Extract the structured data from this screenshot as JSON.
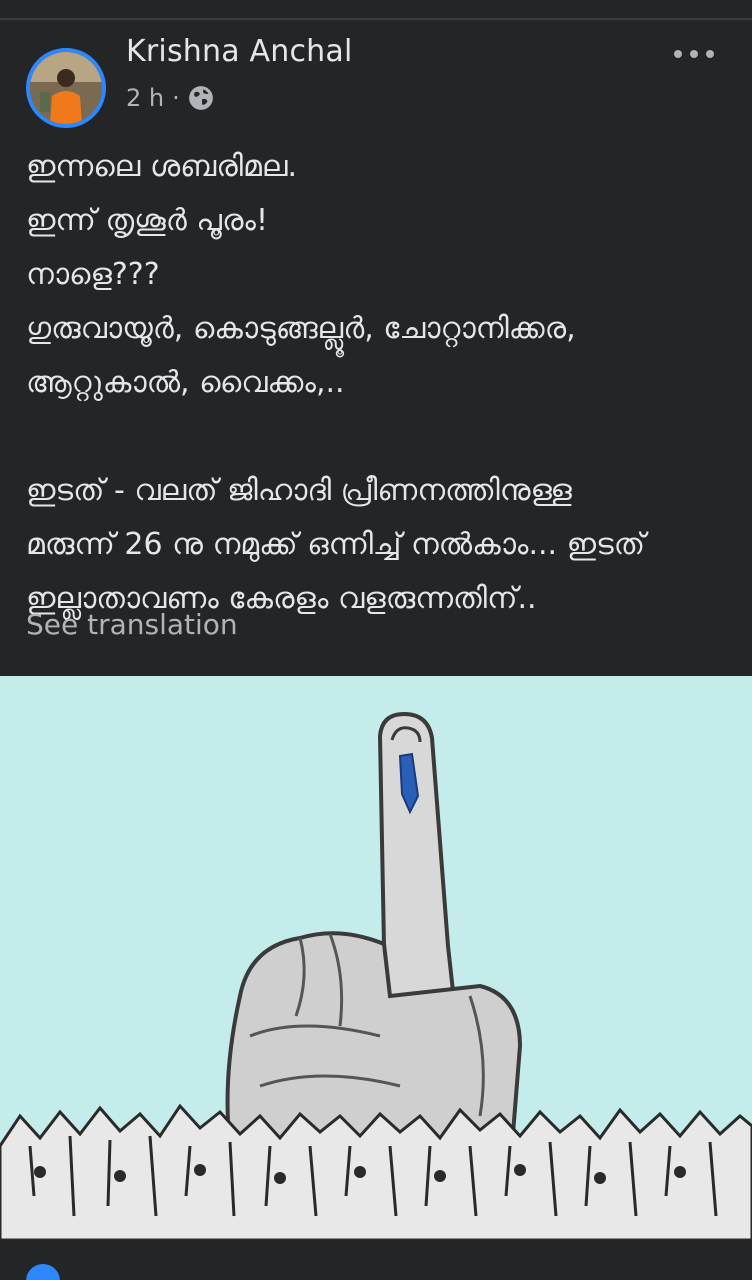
{
  "post": {
    "author_name": "Krishna Anchal",
    "time": "2 h",
    "separator": "·",
    "privacy_icon": "globe-icon",
    "more_icon": "more-options-icon",
    "text_lines": [
      "ഇന്നലെ ശബരിമല.",
      "ഇന്ന് തൃശൂർ പൂരം!",
      "നാളെ???",
      "ഗുരുവായൂർ, കൊടുങ്ങല്ലൂർ, ചോറ്റാനിക്കര,",
      "ആറ്റുകാൽ, വൈക്കം,..",
      "ഇടത് - വലത്  ജിഹാദി പ്രീണനത്തിനുള്ള",
      "മരുന്ന് 26 നു നമുക്ക് ഒന്നിച്ച് നൽകാം... ഇടത്",
      "ഇല്ലാതാവണം കേരളം വളരുന്നതിന്.."
    ],
    "see_translation": "See translation",
    "image_icon": "voting-finger-illustration"
  },
  "colors": {
    "background": "#242526",
    "text": "#e4e6eb",
    "secondary_text": "#b0b3b8",
    "accent": "#2d88ff",
    "image_background": "#c3eceb"
  }
}
